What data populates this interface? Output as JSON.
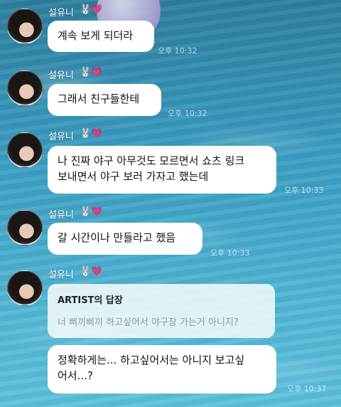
{
  "colors": {
    "bubble": "#ffffff",
    "name_text": "#ffffff",
    "reply_muted": "#8a9aa3"
  },
  "sender": {
    "name": "설유니",
    "icons": "🐰💗"
  },
  "messages": [
    {
      "text": "계속 보게 되더라",
      "time": "오후 10:32"
    },
    {
      "text": "그래서 친구들한테",
      "time": "오후 10:32"
    },
    {
      "text": "나 진짜 야구 아무것도 모르면서 쇼츠 링크\n보내면서 야구 보러 가자고 했는데",
      "time": "오후 10:33"
    },
    {
      "text": "갈 시간이나 만들라고 했음",
      "time": "오후 10:33"
    }
  ],
  "reply": {
    "title": "ARTIST의 답장",
    "quoted": "너 삐끼삐끼 하고싶어서 야구장 가는거 아니지?",
    "text": "정확하게는... 하고싶어서는 아니지 보고싶\n어서...?",
    "time": "오후 10:37"
  }
}
